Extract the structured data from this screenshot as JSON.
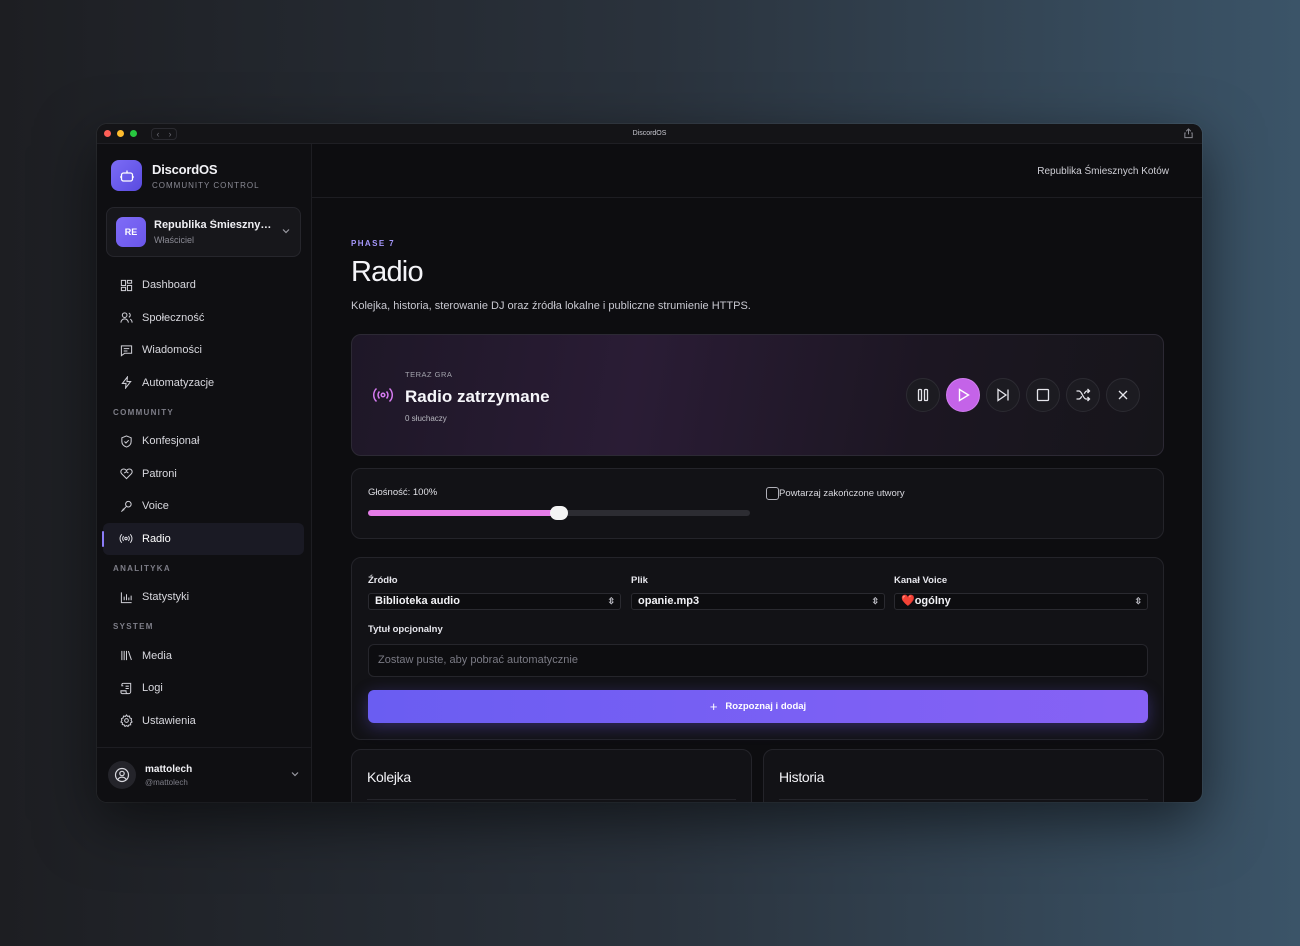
{
  "window": {
    "title": "DiscordOS"
  },
  "brand": {
    "name": "DiscordOS",
    "subtitle": "COMMUNITY CONTROL"
  },
  "server": {
    "initials": "RE",
    "name": "Republika Śmiesznych Kotów",
    "name_display": "Republika Śmiesznyc...",
    "role": "Właściciel"
  },
  "sidebar": {
    "items": [
      {
        "label": "Dashboard",
        "icon": "dashboard-icon"
      },
      {
        "label": "Społeczność",
        "icon": "users-icon"
      },
      {
        "label": "Wiadomości",
        "icon": "message-icon"
      },
      {
        "label": "Automatyzacje",
        "icon": "bolt-icon"
      }
    ],
    "community_title": "COMMUNITY",
    "community": [
      {
        "label": "Konfesjonał",
        "icon": "shield-icon"
      },
      {
        "label": "Patroni",
        "icon": "heart-handshake-icon"
      },
      {
        "label": "Voice",
        "icon": "mic-icon"
      },
      {
        "label": "Radio",
        "icon": "radio-icon",
        "active": true
      }
    ],
    "analytics_title": "ANALITYKA",
    "analytics": [
      {
        "label": "Statystyki",
        "icon": "bar-chart-icon"
      }
    ],
    "system_title": "SYSTEM",
    "system": [
      {
        "label": "Media",
        "icon": "library-icon"
      },
      {
        "label": "Logi",
        "icon": "scroll-icon"
      },
      {
        "label": "Ustawienia",
        "icon": "gear-icon"
      }
    ]
  },
  "user": {
    "name": "mattolech",
    "handle": "@mattolech"
  },
  "topbar": {
    "server": "Republika Śmiesznych Kotów"
  },
  "page": {
    "phase": "PHASE 7",
    "title": "Radio",
    "description": "Kolejka, historia, sterowanie DJ oraz źródła lokalne i publiczne strumienie HTTPS."
  },
  "now_playing": {
    "label": "TERAZ GRA",
    "title": "Radio zatrzymane",
    "listeners": "0 słuchaczy"
  },
  "volume": {
    "label": "Głośność: 100%",
    "level": 0.5,
    "repeat_label": "Powtarzaj zakończone utwory",
    "repeat_checked": false
  },
  "source": {
    "source_label": "Źródło",
    "source_value": "Biblioteka audio",
    "file_label": "Plik",
    "file_value": "opanie.mp3",
    "channel_label": "Kanał Voice",
    "channel_value": "❤️ogólny",
    "title_label": "Tytuł opcjonalny",
    "title_placeholder": "Zostaw puste, aby pobrać automatycznie",
    "add_button": "Rozpoznaj i dodaj"
  },
  "panels": {
    "queue_title": "Kolejka",
    "history_title": "Historia"
  },
  "colors": {
    "accent": "#8b7cf8",
    "play": "#c463e8",
    "slider": "#e57ce8"
  }
}
